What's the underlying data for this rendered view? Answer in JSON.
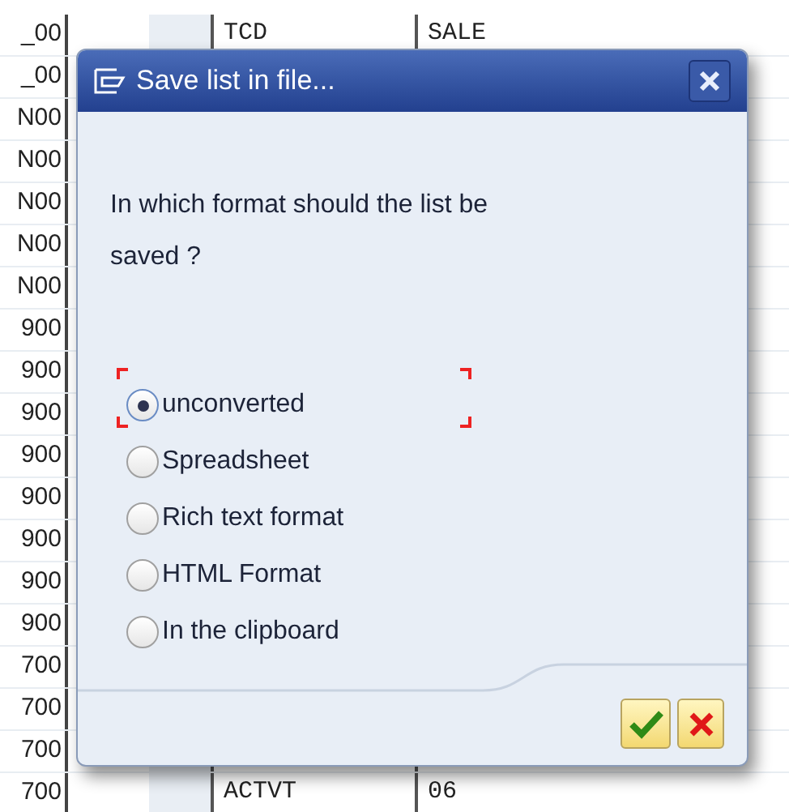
{
  "table": {
    "rows": [
      {
        "column_1": "_00",
        "column_3": "TCD",
        "column_4": "SALE"
      },
      {
        "column_1": "_00"
      },
      {
        "column_1": "N00"
      },
      {
        "column_1": "N00"
      },
      {
        "column_1": "N00"
      },
      {
        "column_1": "N00"
      },
      {
        "column_1": "N00"
      },
      {
        "column_1": "900"
      },
      {
        "column_1": "900"
      },
      {
        "column_1": "900"
      },
      {
        "column_1": "900"
      },
      {
        "column_1": "900"
      },
      {
        "column_1": "900"
      },
      {
        "column_1": "900"
      },
      {
        "column_1": "900"
      },
      {
        "column_1": "700"
      },
      {
        "column_1": "700"
      },
      {
        "column_1": "700"
      },
      {
        "column_1": "700",
        "column_3": "ACTVT",
        "column_4": "06"
      }
    ]
  },
  "dialog": {
    "title": "Save list in file...",
    "question": "In which format should the list be saved ?",
    "options": [
      {
        "label": "unconverted",
        "selected": true
      },
      {
        "label": "Spreadsheet",
        "selected": false
      },
      {
        "label": "Rich text format",
        "selected": false
      },
      {
        "label": "HTML Format",
        "selected": false
      },
      {
        "label": "In the clipboard",
        "selected": false
      }
    ]
  }
}
